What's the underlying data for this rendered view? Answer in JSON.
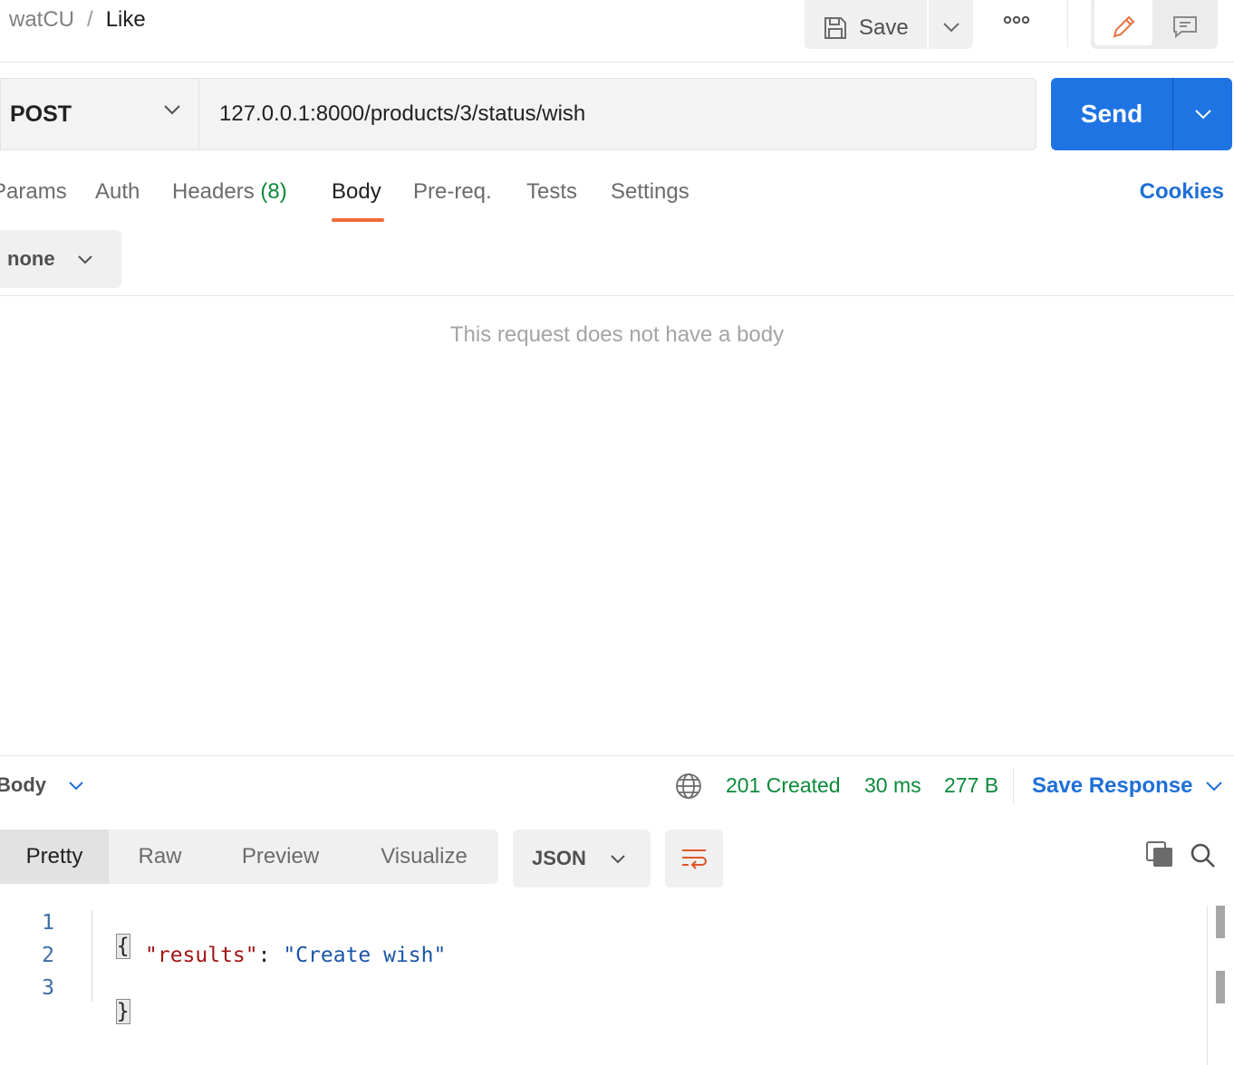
{
  "breadcrumb": {
    "parent": "watCU",
    "separator": "/",
    "current": "Like"
  },
  "header": {
    "save_label": "Save"
  },
  "request": {
    "method": "POST",
    "url": "127.0.0.1:8000/products/3/status/wish",
    "send_label": "Send"
  },
  "tabs": {
    "params": "Params",
    "auth": "Auth",
    "headers": "Headers",
    "headers_count": "(8)",
    "body": "Body",
    "prereq": "Pre-req.",
    "tests": "Tests",
    "settings": "Settings",
    "active": "Body"
  },
  "cookies_label": "Cookies",
  "body_type": "none",
  "empty_body_message": "This request does not have a body",
  "response": {
    "section_label": "Body",
    "status": "201 Created",
    "time": "30 ms",
    "size": "277 B",
    "save_response_label": "Save Response",
    "view_tabs": [
      "Pretty",
      "Raw",
      "Preview",
      "Visualize"
    ],
    "active_view": "Pretty",
    "format": "JSON",
    "lines": [
      {
        "no": "1",
        "open": "{"
      },
      {
        "no": "2",
        "key": "\"results\"",
        "colon": ": ",
        "value": "\"Create wish\""
      },
      {
        "no": "3",
        "close": "}"
      }
    ]
  },
  "colors": {
    "accent_blue": "#1f74e3",
    "status_green": "#0c8a3a",
    "active_tab_orange": "#f26b3a"
  },
  "icons": [
    "save-icon",
    "chevron-down-icon",
    "more-icon",
    "pencil-icon",
    "comment-icon",
    "globe-icon",
    "wrap-lines-icon",
    "copy-icon",
    "search-icon"
  ]
}
